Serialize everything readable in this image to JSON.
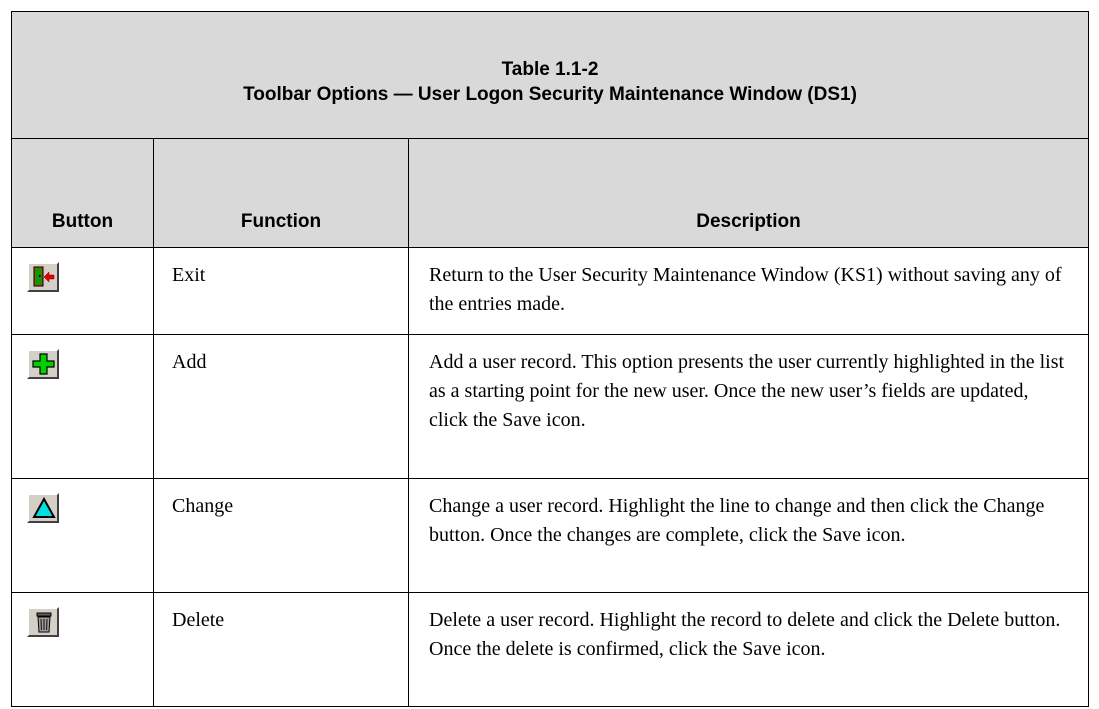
{
  "table": {
    "caption_line1": "Table 1.1-2",
    "caption_line2": "Toolbar Options — User Logon Security Maintenance Window (DS1)",
    "headers": {
      "button": "Button",
      "function": "Function",
      "description": "Description"
    },
    "rows": [
      {
        "icon": "exit-door-icon",
        "function": "Exit",
        "description": "Return to the User Security Maintenance Window (KS1) without saving any of the entries made."
      },
      {
        "icon": "add-plus-icon",
        "function": "Add",
        "description": "Add a user record. This option presents the user currently highlighted in the list as a starting point for the new user. Once the new user’s fields are updated, click the Save icon."
      },
      {
        "icon": "change-triangle-icon",
        "function": "Change",
        "description": "Change a user record. Highlight the line to change and then click the Change button. Once the changes are complete, click the Save icon."
      },
      {
        "icon": "delete-trash-icon",
        "function": "Delete",
        "description": "Delete a user record. Highlight the record to delete and click the Delete button. Once the delete is confirmed, click the Save icon."
      }
    ]
  }
}
